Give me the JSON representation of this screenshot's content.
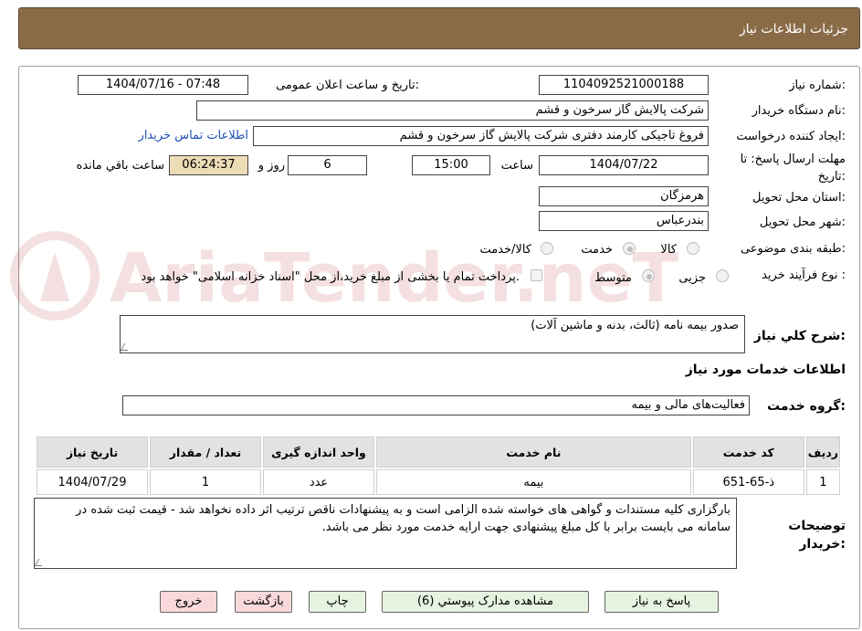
{
  "header": {
    "title": "جزئیات اطلاعات نیاز"
  },
  "form": {
    "need_number_label": "شماره نیاز:",
    "need_number": "1104092521000188",
    "announce_label": "تاریخ و ساعت اعلان عمومی:",
    "announce_value": "1404/07/16 - 07:48",
    "buyer_org_label": "نام دستگاه خریدار:",
    "buyer_org": "شرکت پالایش گاز سرخون و قشم",
    "creator_label": "ایجاد کننده درخواست:",
    "creator": "فروغ تاجیکی کارمند دفتری شرکت پالایش گاز سرخون و قشم",
    "contact_link": "اطلاعات تماس خریدار",
    "deadline_label": "مهلت ارسال پاسخ: تا تاریخ:",
    "deadline_date": "1404/07/22",
    "time_label": "ساعت",
    "deadline_time": "15:00",
    "days_value": "6",
    "days_label": "روز و",
    "remaining_time": "06:24:37",
    "remaining_label": "ساعت باقي مانده",
    "province_label": "استان محل تحویل:",
    "province": "هرمزگان",
    "city_label": "شهر محل تحویل:",
    "city": "بندرعباس",
    "category_label": "طبقه بندی موضوعی:",
    "category_options": [
      "کالا",
      "خدمت",
      "کالا/خدمت"
    ],
    "category_selected": "خدمت",
    "process_label": "نوع فرآیند خرید :",
    "process_options": [
      "جزیی",
      "متوسط"
    ],
    "process_selected": "متوسط",
    "payment_note": "پرداخت تمام یا بخشی از مبلغ خرید،از محل \"اسناد خزانه اسلامی\" خواهد بود."
  },
  "description": {
    "label": "شرح کلي نیاز:",
    "value": "صدور بیمه نامه (ثالث، بدنه و ماشین آلات)"
  },
  "services": {
    "section_title": "اطلاعات خدمات مورد نیاز",
    "group_label": "گروه خدمت:",
    "group_value": "فعالیت‌های مالی و بیمه",
    "columns": [
      "ردیف",
      "کد خدمت",
      "نام خدمت",
      "واحد اندازه گیری",
      "تعداد / مقدار",
      "تاریخ نیاز"
    ],
    "rows": [
      {
        "row": "1",
        "code": "ذ-65-651",
        "name": "بیمه",
        "unit": "عدد",
        "qty": "1",
        "date": "1404/07/29"
      }
    ]
  },
  "buyer_notes": {
    "label": "توضیحات خریدار:",
    "value": "بارگزاری کلیه مستندات و گواهی های خواسته شده الزامی است و به پیشنهادات ناقص ترتیب اثر داده نخواهد شد - قیمت ثبت شده در سامانه می بایست برابر با کل مبلغ پیشنهادی جهت ارایه خدمت مورد نظر می باشد."
  },
  "buttons": {
    "reply": "پاسخ به نیاز",
    "attachments": "مشاهده مدارک پیوستي (6)",
    "print": "چاپ",
    "back": "بازگشت",
    "exit": "خروج"
  },
  "watermark": "AriaTender.neT",
  "colors": {
    "header": "#8a6b48",
    "timer": "#ecdcb6",
    "button_green": "#e6f3e0",
    "button_red": "#f8d8da",
    "link": "#1f4fb4"
  }
}
